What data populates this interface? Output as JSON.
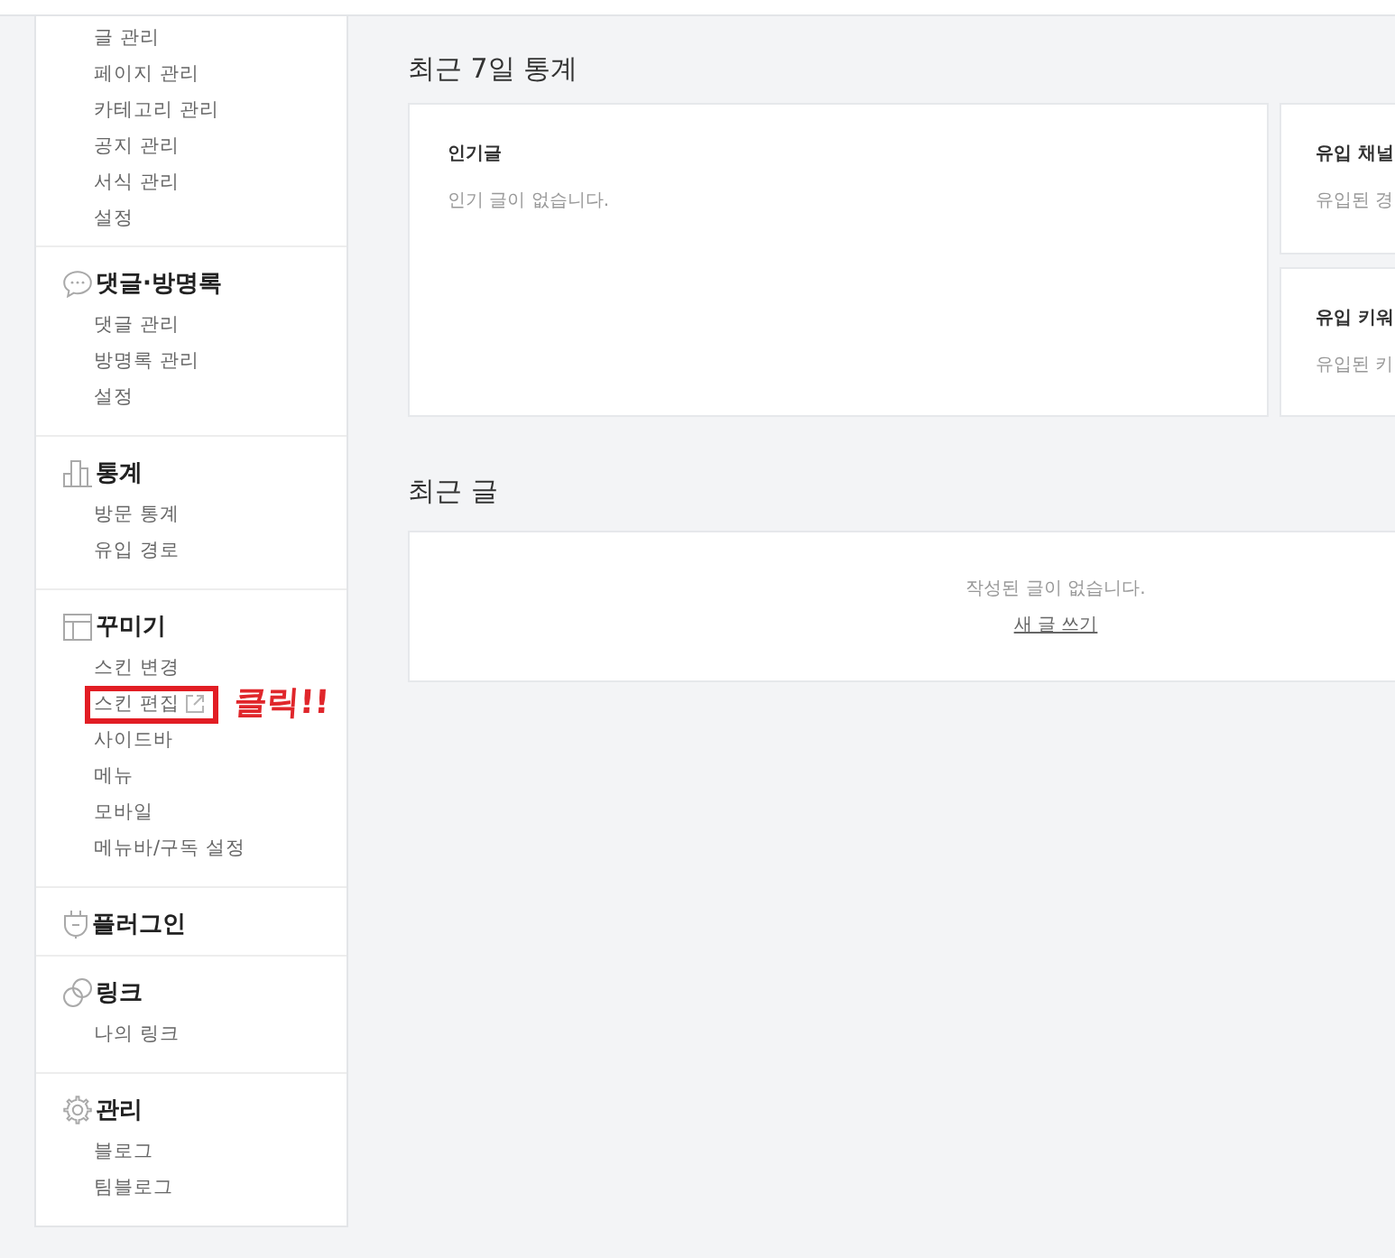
{
  "sidebar": {
    "groups": [
      {
        "items": [
          {
            "label": "글 관리",
            "external": false,
            "highlighted": false
          },
          {
            "label": "페이지 관리",
            "external": false,
            "highlighted": false
          },
          {
            "label": "카테고리 관리",
            "external": false,
            "highlighted": false
          },
          {
            "label": "공지 관리",
            "external": false,
            "highlighted": false
          },
          {
            "label": "서식 관리",
            "external": false,
            "highlighted": false
          },
          {
            "label": "설정",
            "external": false,
            "highlighted": false
          }
        ]
      },
      {
        "kind": "comments",
        "title": "댓글·방명록",
        "items": [
          {
            "label": "댓글 관리",
            "external": false,
            "highlighted": false
          },
          {
            "label": "방명록 관리",
            "external": false,
            "highlighted": false
          },
          {
            "label": "설정",
            "external": false,
            "highlighted": false
          }
        ]
      },
      {
        "kind": "stats",
        "title": "통계",
        "items": [
          {
            "label": "방문 통계",
            "external": false,
            "highlighted": false
          },
          {
            "label": "유입 경로",
            "external": false,
            "highlighted": false
          }
        ]
      },
      {
        "kind": "design",
        "title": "꾸미기",
        "items": [
          {
            "label": "스킨 변경",
            "external": false,
            "highlighted": false
          },
          {
            "label": "스킨 편집",
            "external": true,
            "highlighted": true,
            "note": "클릭!!"
          },
          {
            "label": "사이드바",
            "external": false,
            "highlighted": false
          },
          {
            "label": "메뉴",
            "external": false,
            "highlighted": false
          },
          {
            "label": "모바일",
            "external": false,
            "highlighted": false
          },
          {
            "label": "메뉴바/구독 설정",
            "external": false,
            "highlighted": false
          }
        ]
      },
      {
        "kind": "plugins",
        "title": "플러그인"
      },
      {
        "kind": "links",
        "title": "링크",
        "items": [
          {
            "label": "나의 링크",
            "external": false,
            "highlighted": false
          }
        ]
      },
      {
        "kind": "admin",
        "title": "관리",
        "items": [
          {
            "label": "블로그",
            "external": false,
            "highlighted": false
          },
          {
            "label": "팀블로그",
            "external": false,
            "highlighted": false
          }
        ]
      }
    ]
  },
  "stats": {
    "title": "최근 7일 통계",
    "cards": [
      {
        "title": "인기글",
        "message": "인기 글이 없습니다."
      },
      {
        "title": "유입 채널",
        "message": "유입된 경"
      },
      {
        "title": "유입 키워",
        "message": "유입된 키"
      }
    ]
  },
  "recent": {
    "title": "최근 글",
    "message": "작성된 글이 없습니다.",
    "link": "새 글 쓰기"
  }
}
